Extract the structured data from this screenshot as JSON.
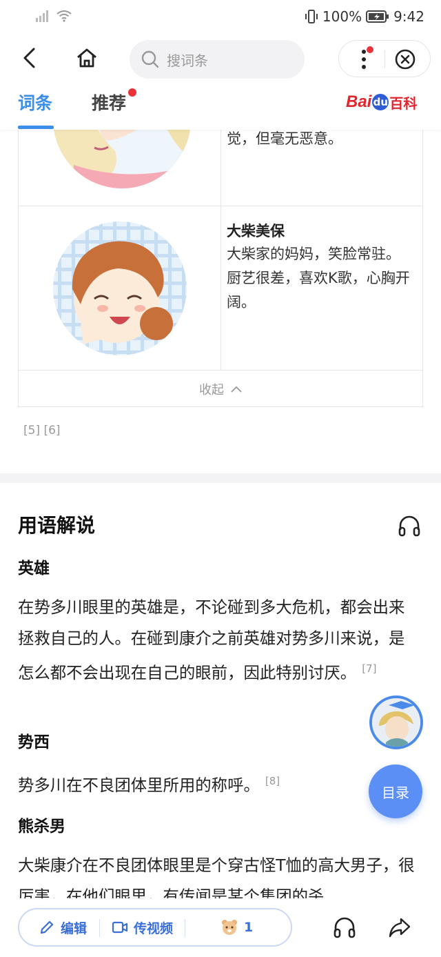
{
  "status": {
    "battery": "100%",
    "time": "9:42"
  },
  "nav": {
    "search_placeholder": "搜词条"
  },
  "tabs": [
    {
      "label": "词条"
    },
    {
      "label": "推荐"
    }
  ],
  "logo": {
    "bai": "Bai",
    "du": "du",
    "baike": "百科"
  },
  "characters": {
    "row1_text": "觉，但毫无恶意。",
    "row2_name": "大柴美保",
    "row2_desc_1": "大柴家的妈妈，笑脸常驻。",
    "row2_desc_2": "厨艺很差，喜欢K歌，心胸开阔。"
  },
  "collapse_label": "收起",
  "refs_1": "[5] [6]",
  "section": {
    "title": "用语解说"
  },
  "terms": [
    {
      "name": "英雄",
      "text": "在势多川眼里的英雄是，不论碰到多大危机，都会出来拯救自己的人。在碰到康介之前英雄对势多川来说，是怎么都不会出现在自己的眼前，因此特别讨厌。",
      "ref": "[7]"
    },
    {
      "name": "势西",
      "text": "势多川在不良团体里所用的称呼。",
      "ref": "[8]"
    },
    {
      "name": "熊杀男",
      "text": "大柴康介在不良团体眼里是个穿古怪T恤的高大男子，很厉害，在他们眼里，有传闻是某个集团的杀"
    }
  ],
  "toc_label": "目录",
  "bottom": {
    "edit": "编辑",
    "video": "传视频",
    "likes": "1"
  },
  "colors": {
    "accent": "#3b8eea",
    "toc": "#5b8ff5",
    "badge": "#e8333a"
  }
}
